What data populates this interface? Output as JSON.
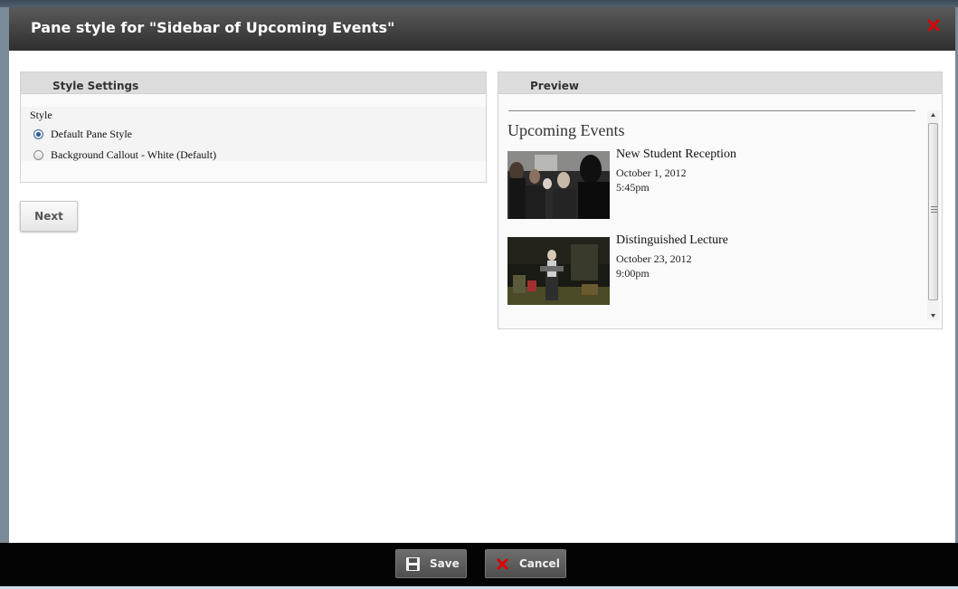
{
  "dialog": {
    "title": "Pane style for \"Sidebar of Upcoming Events\"",
    "close_icon": "close-icon",
    "accent_close_color": "#e00000"
  },
  "style_settings": {
    "header": "Style Settings",
    "field_label": "Style",
    "options": [
      {
        "label": "Default Pane Style",
        "selected": true
      },
      {
        "label": "Background Callout - White (Default)",
        "selected": false
      }
    ],
    "next_label": "Next"
  },
  "preview": {
    "header": "Preview",
    "heading": "Upcoming Events",
    "events": [
      {
        "title": "New Student Reception",
        "date": "October 1, 2012",
        "time": "5:45pm"
      },
      {
        "title": "Distinguished Lecture",
        "date": "October 23, 2012",
        "time": "9:00pm"
      }
    ]
  },
  "footer": {
    "save_label": "Save",
    "cancel_label": "Cancel",
    "save_icon": "floppy-disk-icon",
    "cancel_icon": "red-x-icon"
  }
}
